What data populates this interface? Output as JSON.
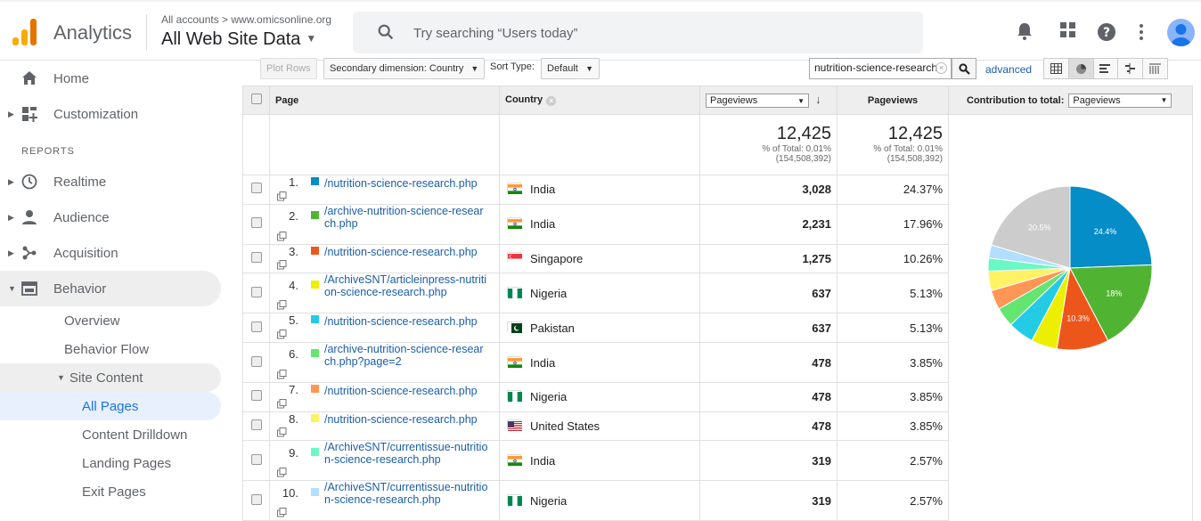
{
  "app": {
    "name": "Analytics",
    "breadcrumb": "All accounts > www.omicsonline.org",
    "account": "All Web Site Data",
    "search_placeholder": "Try searching “Users today”"
  },
  "icons": [
    "analytics-logo-icon",
    "search-icon",
    "bell-icon",
    "apps-icon",
    "help-icon",
    "more-vert-icon",
    "avatar-icon"
  ],
  "sidebar": {
    "home": "Home",
    "customization": "Customization",
    "reports_label": "REPORTS",
    "realtime": "Realtime",
    "audience": "Audience",
    "acquisition": "Acquisition",
    "behavior": "Behavior",
    "overview": "Overview",
    "behavior_flow": "Behavior Flow",
    "site_content": "Site Content",
    "all_pages": "All Pages",
    "content_drilldown": "Content Drilldown",
    "landing_pages": "Landing Pages",
    "exit_pages": "Exit Pages"
  },
  "toolbar": {
    "plot_rows": "Plot Rows",
    "secondary_dimension": "Secondary dimension: Country",
    "sort_type_label": "Sort Type:",
    "sort_type_value": "Default",
    "filter_value": "nutrition-science-research",
    "advanced": "advanced"
  },
  "table": {
    "headers": {
      "page": "Page",
      "country": "Country",
      "metric_select": "Pageviews",
      "pageviews": "Pageviews",
      "contribution_label": "Contribution to total:",
      "contribution_select": "Pageviews"
    },
    "totals": {
      "value1": "12,425",
      "pct1": "% of Total: 0.01%",
      "of1": "(154,508,392)",
      "value2": "12,425",
      "pct2": "% of Total: 0.01%",
      "of2": "(154,508,392)"
    },
    "rows": [
      {
        "index": "1.",
        "page": "/nutrition-science-research.php",
        "color": "#058dc7",
        "country": "India",
        "flag": "india",
        "pageviews": "3,028",
        "percent": "24.37%"
      },
      {
        "index": "2.",
        "page": "/archive-nutrition-science-research.php",
        "color": "#50b432",
        "country": "India",
        "flag": "india",
        "pageviews": "2,231",
        "percent": "17.96%"
      },
      {
        "index": "3.",
        "page": "/nutrition-science-research.php",
        "color": "#ed561b",
        "country": "Singapore",
        "flag": "singapore",
        "pageviews": "1,275",
        "percent": "10.26%"
      },
      {
        "index": "4.",
        "page": "/ArchiveSNT/articleinpress-nutrition-science-research.php",
        "color": "#edef00",
        "country": "Nigeria",
        "flag": "nigeria",
        "pageviews": "637",
        "percent": "5.13%"
      },
      {
        "index": "5.",
        "page": "/nutrition-science-research.php",
        "color": "#24cbe5",
        "country": "Pakistan",
        "flag": "pakistan",
        "pageviews": "637",
        "percent": "5.13%"
      },
      {
        "index": "6.",
        "page": "/archive-nutrition-science-research.php?page=2",
        "color": "#64e572",
        "country": "India",
        "flag": "india",
        "pageviews": "478",
        "percent": "3.85%"
      },
      {
        "index": "7.",
        "page": "/nutrition-science-research.php",
        "color": "#ff9655",
        "country": "Nigeria",
        "flag": "nigeria",
        "pageviews": "478",
        "percent": "3.85%"
      },
      {
        "index": "8.",
        "page": "/nutrition-science-research.php",
        "color": "#fff263",
        "country": "United States",
        "flag": "us",
        "pageviews": "478",
        "percent": "3.85%"
      },
      {
        "index": "9.",
        "page": "/ArchiveSNT/currentissue-nutrition-science-research.php",
        "color": "#6af9c4",
        "country": "India",
        "flag": "india",
        "pageviews": "319",
        "percent": "2.57%"
      },
      {
        "index": "10.",
        "page": "/ArchiveSNT/currentissue-nutrition-science-research.php",
        "color": "#b2deff",
        "country": "Nigeria",
        "flag": "nigeria",
        "pageviews": "319",
        "percent": "2.57%"
      }
    ]
  },
  "chart_data": {
    "type": "pie",
    "values": [
      24.37,
      17.96,
      10.26,
      5.13,
      5.13,
      3.85,
      3.85,
      3.85,
      2.57,
      2.57,
      20.46
    ],
    "colors": [
      "#058dc7",
      "#50b432",
      "#ed561b",
      "#edef00",
      "#24cbe5",
      "#64e572",
      "#ff9655",
      "#fff263",
      "#6af9c4",
      "#b2deff",
      "#cccccc"
    ],
    "labels": [
      "24.4%",
      "18%",
      "10.3%",
      "",
      "",
      "",
      "",
      "",
      "",
      "",
      "20.5%"
    ]
  }
}
